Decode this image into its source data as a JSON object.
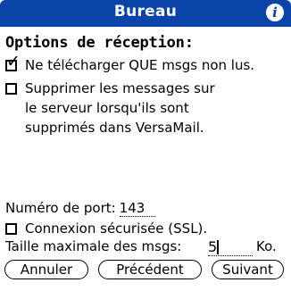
{
  "title": "Bureau",
  "info_icon": "i",
  "heading": "Options de réception:",
  "options": [
    {
      "label": "Ne télécharger QUE msgs non lus.",
      "checked": true
    },
    {
      "lines": [
        "Supprimer les messages sur",
        "le serveur lorsqu'ils sont",
        "supprimés dans VersaMail."
      ],
      "checked": false
    }
  ],
  "port": {
    "label": "Numéro de port:",
    "value": "143"
  },
  "ssl": {
    "label": "Connexion sécurisée (SSL).",
    "checked": false
  },
  "max_size": {
    "label": "Taille maximale des msgs:",
    "value": "5",
    "unit": "Ko."
  },
  "buttons": {
    "cancel": "Annuler",
    "previous": "Précédent",
    "next": "Suivant"
  },
  "colors": {
    "titlebar": "#0a44a8"
  }
}
